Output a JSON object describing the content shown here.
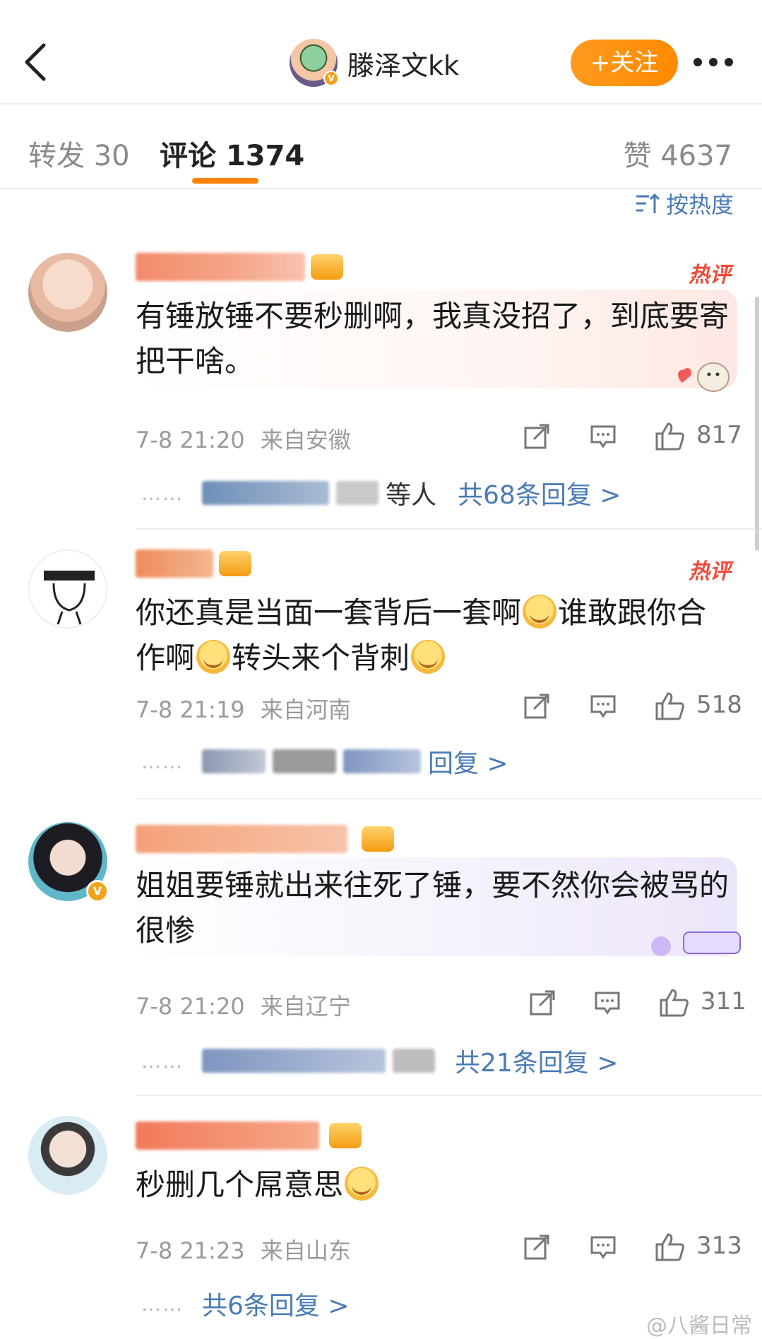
{
  "header": {
    "username": "滕泽文kk",
    "follow_label": "+关注"
  },
  "tabs": {
    "repost": "转发 30",
    "comments": "评论 1374",
    "likes": "赞 4637"
  },
  "sort_label": "按热度",
  "hot_label": "热评",
  "comments": [
    {
      "text": "有锤放锤不要秒删啊，我真没招了，到底要寄把干啥。",
      "time": "7-8 21:20",
      "location": "来自安徽",
      "likes": "817",
      "reply_tail": "等人",
      "reply_link": "共68条回复 >"
    },
    {
      "text_parts": [
        "你还真是当面一套背后一套啊",
        "谁敢跟你合作啊",
        "转头来个背刺"
      ],
      "time": "7-8 21:19",
      "location": "来自河南",
      "likes": "518",
      "reply_link": "回复 >"
    },
    {
      "text": "姐姐要锤就出来往死了锤，要不然你会被骂的很惨",
      "time": "7-8 21:20",
      "location": "来自辽宁",
      "likes": "311",
      "reply_link": "共21条回复 >"
    },
    {
      "text": "秒删几个屌意思",
      "time": "7-8 21:23",
      "location": "来自山东",
      "likes": "313",
      "reply_link": "共6条回复 >"
    }
  ],
  "dots": "……",
  "watermark": "@八酱日常",
  "colors": {
    "accent": "#ff8200",
    "link": "#4a7bb5",
    "hot": "#ef4b3b"
  }
}
